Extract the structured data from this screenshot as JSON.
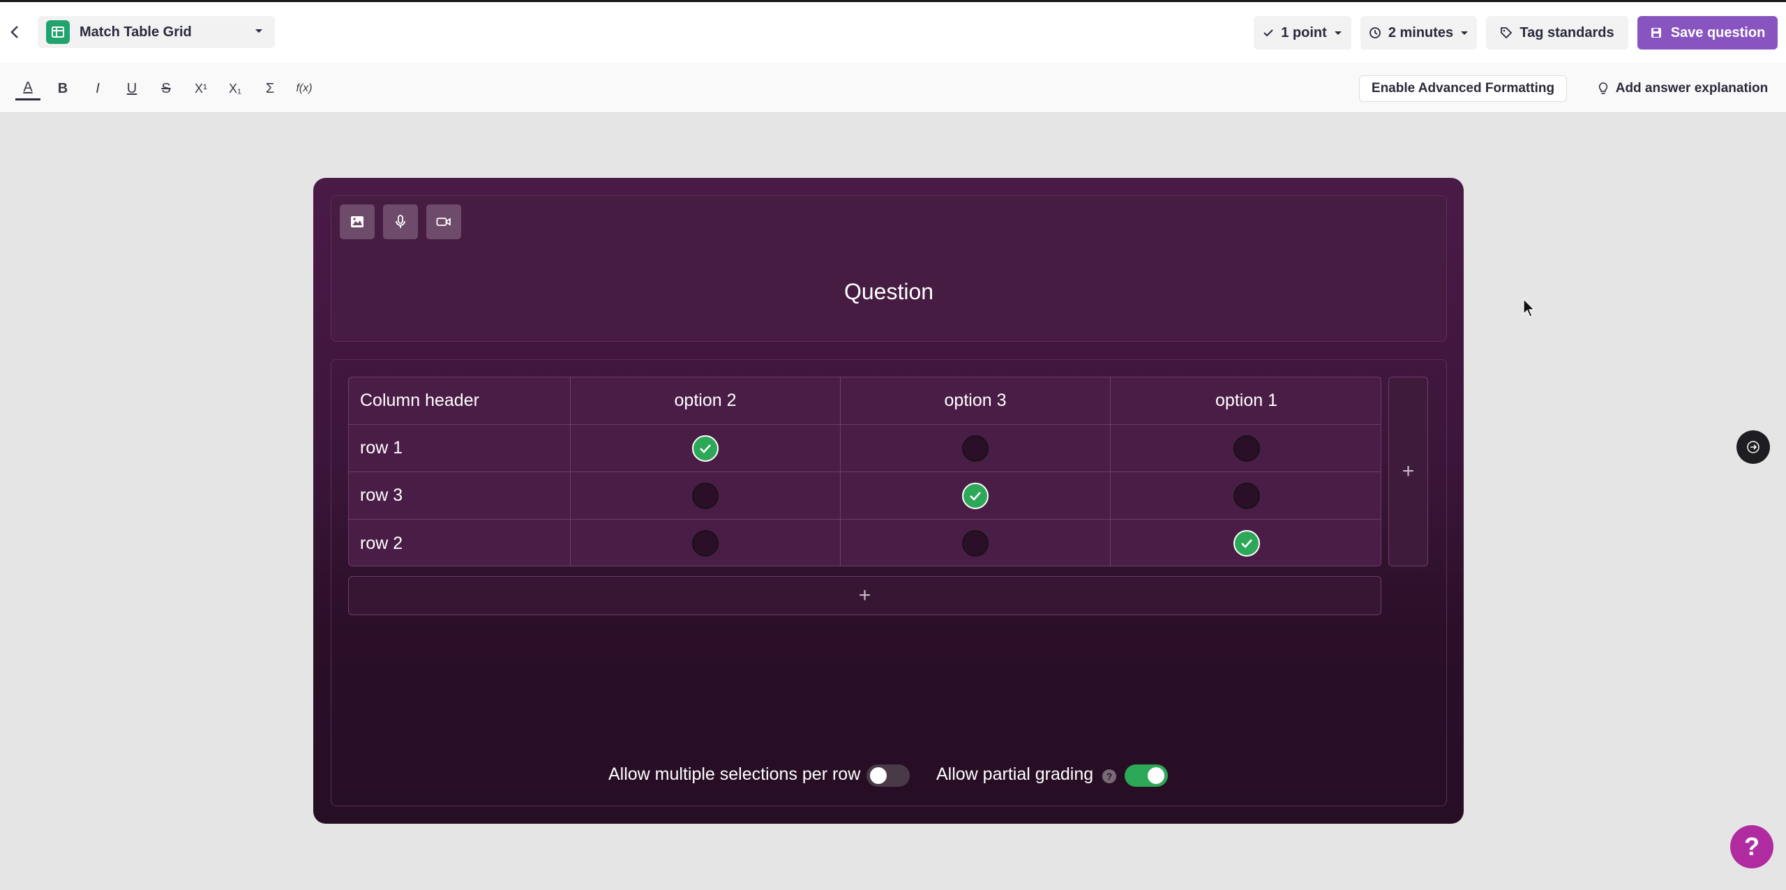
{
  "header": {
    "question_type": "Match Table Grid",
    "points": "1 point",
    "time": "2 minutes",
    "tag_label": "Tag standards",
    "save_label": "Save question"
  },
  "format_toolbar": {
    "bold": "B",
    "italic": "I",
    "underline": "U",
    "strike": "S",
    "superscript": "X¹",
    "subscript": "X₁",
    "sum": "Σ",
    "function": "f(x)",
    "text_color": "A",
    "advanced_label": "Enable Advanced Formatting",
    "explanation_label": "Add answer explanation"
  },
  "question": {
    "placeholder": "Question"
  },
  "grid": {
    "header_label": "Column header",
    "columns": [
      "option 2",
      "option 3",
      "option 1"
    ],
    "rows": [
      {
        "label": "row 1",
        "selected": 0
      },
      {
        "label": "row 3",
        "selected": 1
      },
      {
        "label": "row 2",
        "selected": 2
      }
    ],
    "add_symbol": "+"
  },
  "settings": {
    "multiple_label": "Allow multiple selections per row",
    "multiple_on": false,
    "partial_label": "Allow partial grading",
    "partial_on": true,
    "help_symbol": "?"
  },
  "fab": {
    "help_symbol": "?"
  },
  "colors": {
    "accent": "#8854c0",
    "selected": "#2da859",
    "card_top": "#4a1a47",
    "card_bottom": "#260e24",
    "toggle_on": "#2da859",
    "toggle_off": "#4a3a48"
  }
}
